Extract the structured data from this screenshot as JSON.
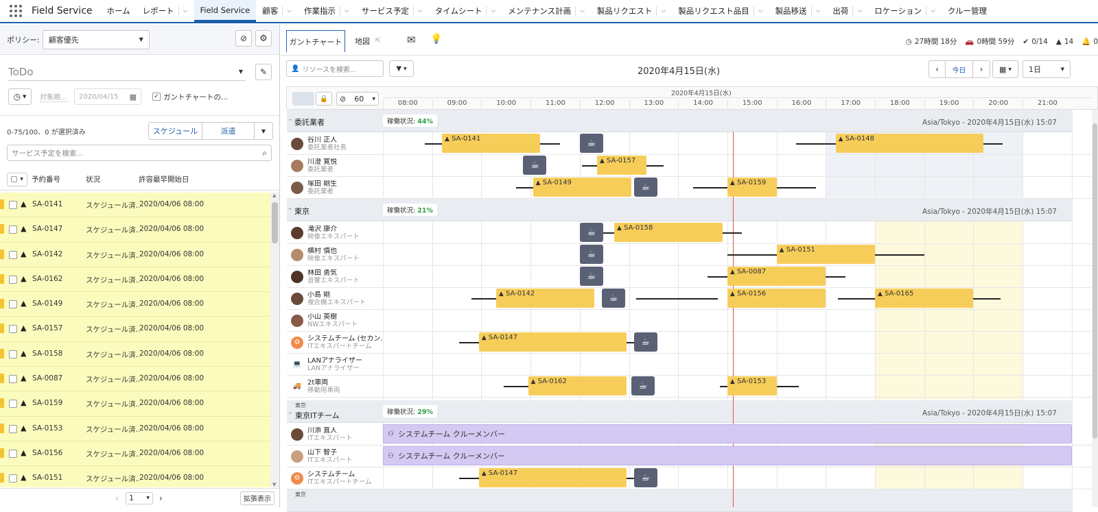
{
  "nav": {
    "app_name": "Field Service",
    "items": [
      {
        "label": "ホーム",
        "chevron": false
      },
      {
        "label": "レポート",
        "chevron": true
      },
      {
        "label": "Field Service",
        "chevron": false,
        "active": true
      },
      {
        "label": "顧客",
        "chevron": true
      },
      {
        "label": "作業指示",
        "chevron": true
      },
      {
        "label": "サービス予定",
        "chevron": true
      },
      {
        "label": "タイムシート",
        "chevron": true
      },
      {
        "label": "メンテナンス計画",
        "chevron": true
      },
      {
        "label": "製品リクエスト",
        "chevron": true
      },
      {
        "label": "製品リクエスト品目",
        "chevron": true
      },
      {
        "label": "製品移送",
        "chevron": true
      },
      {
        "label": "出荷",
        "chevron": true
      },
      {
        "label": "ロケーション",
        "chevron": true
      },
      {
        "label": "クルー管理",
        "chevron": false
      }
    ]
  },
  "left": {
    "policy_label": "ポリシー:",
    "policy_value": "顧客優先",
    "list_view": "ToDo",
    "ref_period_placeholder": "対象期...",
    "date_value": "2020/04/15",
    "gantt_checkbox_label": "ガントチャートの...",
    "count_text": "0-75/100、0 が選択済み",
    "schedule_button": "スケジュール",
    "dispatch_button": "派遣",
    "search_placeholder": "サービス予定を検索...",
    "columns": [
      "予約番号",
      "状況",
      "許容最早開始日"
    ],
    "rows": [
      {
        "id": "SA-0141",
        "status": "スケジュール済...",
        "date": "2020/04/06 08:00"
      },
      {
        "id": "SA-0147",
        "status": "スケジュール済...",
        "date": "2020/04/06 08:00"
      },
      {
        "id": "SA-0142",
        "status": "スケジュール済...",
        "date": "2020/04/06 08:00"
      },
      {
        "id": "SA-0162",
        "status": "スケジュール済...",
        "date": "2020/04/06 08:00"
      },
      {
        "id": "SA-0149",
        "status": "スケジュール済...",
        "date": "2020/04/06 08:00"
      },
      {
        "id": "SA-0157",
        "status": "スケジュール済...",
        "date": "2020/04/06 08:00"
      },
      {
        "id": "SA-0158",
        "status": "スケジュール済...",
        "date": "2020/04/06 08:00"
      },
      {
        "id": "SA-0087",
        "status": "スケジュール済...",
        "date": "2020/04/06 08:00"
      },
      {
        "id": "SA-0159",
        "status": "スケジュール済...",
        "date": "2020/04/06 08:00"
      },
      {
        "id": "SA-0153",
        "status": "スケジュール済...",
        "date": "2020/04/06 08:00"
      },
      {
        "id": "SA-0156",
        "status": "スケジュール済...",
        "date": "2020/04/06 08:00"
      },
      {
        "id": "SA-0151",
        "status": "スケジュール済...",
        "date": "2020/04/06 08:00"
      }
    ],
    "page": "1",
    "extended_button": "拡張表示"
  },
  "right": {
    "tabs": [
      "ガントチャート",
      "地図"
    ],
    "stats": {
      "travel": "27時間 18分",
      "drive": "0時間 59分",
      "done": "0/14",
      "warnings": "14",
      "bell": "0"
    },
    "resource_search_placeholder": "リソースを検索...",
    "date_title": "2020年4月15日(水)",
    "today_button": "今日",
    "range_value": "1日",
    "zoom_value": "60",
    "timeline_date": "2020年4月15日(水)",
    "hours": [
      "08:00",
      "09:00",
      "10:00",
      "11:00",
      "12:00",
      "13:00",
      "14:00",
      "15:00",
      "16:00",
      "17:00",
      "18:00",
      "19:00",
      "20:00",
      "21:00"
    ],
    "util_label": "稼働状況:",
    "groups": [
      {
        "name": "委託業者",
        "util": "44%",
        "tz": "Asia/Tokyo - 2020年4月15日(水) 15:07"
      },
      {
        "name": "東京",
        "util": "21%",
        "tz": "Asia/Tokyo - 2020年4月15日(水) 15:07"
      },
      {
        "name": "東京ITチーム",
        "parent": "東京",
        "util": "29%",
        "tz": "Asia/Tokyo - 2020年4月15日(水) 15:07"
      }
    ],
    "resources": [
      {
        "name": "谷川 正人",
        "sub": "委託業者社長"
      },
      {
        "name": "川澄 寛悦",
        "sub": "委託業者"
      },
      {
        "name": "塚田 剛生",
        "sub": "委託業者"
      },
      {
        "name": "滝沢 康介",
        "sub": "映像エキスパート"
      },
      {
        "name": "横村 慎也",
        "sub": "映像エキスパート"
      },
      {
        "name": "林田 勇気",
        "sub": "音響エキスパート"
      },
      {
        "name": "小島 剛",
        "sub": "複合機エキスパート"
      },
      {
        "name": "小山 英樹",
        "sub": "NWエキスパート"
      },
      {
        "name": "システムチーム (セカン...",
        "sub": "ITエキスパートチーム"
      },
      {
        "name": "LANアナライザー",
        "sub": "LANアナライザー"
      },
      {
        "name": "2t車両",
        "sub": "移動用車両"
      },
      {
        "name": "川添 直人",
        "sub": "ITエキスパート"
      },
      {
        "name": "山下 智子",
        "sub": "ITエキスパート"
      },
      {
        "name": "システムチーム",
        "sub": "ITエキスパートチーム"
      }
    ],
    "bars": [
      "SA-0141",
      "SA-0148",
      "SA-0157",
      "SA-0149",
      "SA-0159",
      "SA-0158",
      "SA-0151",
      "SA-0087",
      "SA-0142",
      "SA-0156",
      "SA-0165",
      "SA-0147",
      "SA-0162",
      "SA-0153",
      "SA-0147"
    ],
    "crew_label": "システムチーム クルーメンバー",
    "bottom_group_label": "東京"
  }
}
